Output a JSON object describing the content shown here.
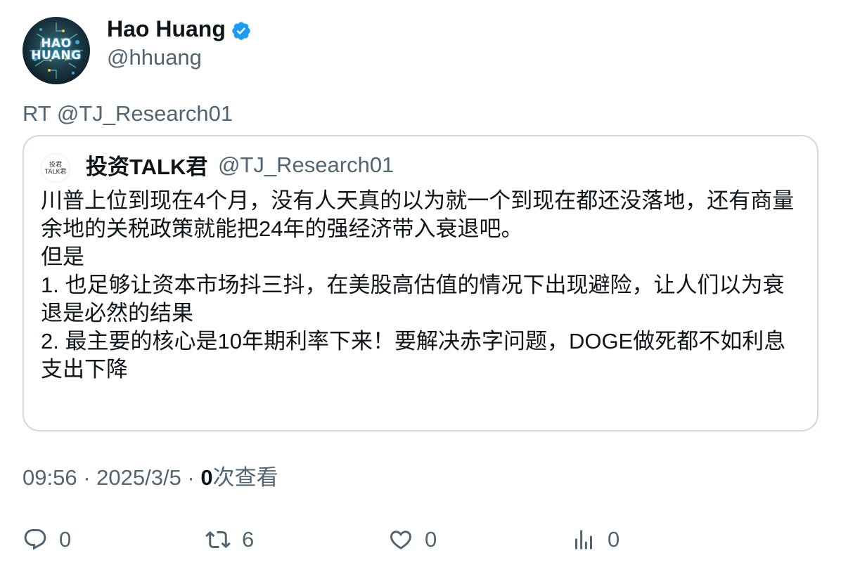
{
  "author": {
    "display_name": "Hao Huang",
    "handle": "@hhuang",
    "avatar_text": "HAO HUANG",
    "verified_icon": "verified-badge-icon"
  },
  "retweet_line": "RT @TJ_Research01",
  "quoted": {
    "display_name": "投资TALK君",
    "handle": "@TJ_Research01",
    "avatar_text": "投君 TALK君",
    "body": "川普上位到现在4个月，没有人天真的以为就一个到现在都还没落地，还有商量余地的关税政策就能把24年的强经济带入衰退吧。\n但是\n1. 也足够让资本市场抖三抖，在美股高估值的情况下出现避险，让人们以为衰退是必然的结果\n2. 最主要的核心是10年期利率下来！要解决赤字问题，DOGE做死都不如利息支出下降"
  },
  "meta": {
    "time": "09:56",
    "sep1": " · ",
    "date": "2025/3/5",
    "sep2": " · ",
    "views_count": "0",
    "views_label": "次查看"
  },
  "actions": {
    "reply": {
      "icon": "reply-icon",
      "count": "0"
    },
    "retweet": {
      "icon": "retweet-icon",
      "count": "6"
    },
    "like": {
      "icon": "heart-icon",
      "count": "0"
    },
    "views": {
      "icon": "analytics-icon",
      "count": "0"
    }
  },
  "colors": {
    "text_primary": "#0f1419",
    "text_secondary": "#536471",
    "border": "#cfd9de",
    "verified": "#1d9bf0"
  }
}
